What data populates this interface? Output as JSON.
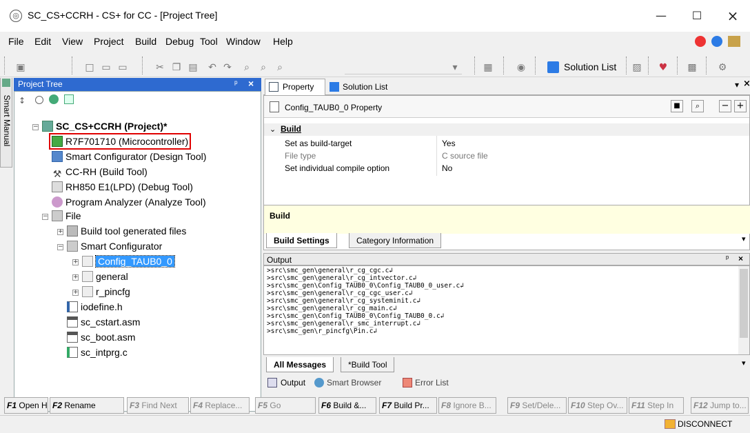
{
  "window": {
    "title": "SC_CS+CCRH - CS+ for CC - [Project Tree]",
    "minimize": "—",
    "maximize": "☐",
    "close": "×"
  },
  "menu": [
    "File",
    "Edit",
    "View",
    "Project",
    "Build",
    "Debug",
    "Tool",
    "Window",
    "Help"
  ],
  "toolbar": {
    "solution_list": "Solution List"
  },
  "side_tab": {
    "label": "Smart Manual"
  },
  "project_tree": {
    "header": "Project Tree",
    "header_pin": "ᵖ",
    "header_close": "×",
    "items": [
      {
        "label": "SC_CS+CCRH (Project)*"
      },
      {
        "label": "R7F701710 (Microcontroller)"
      },
      {
        "label": "Smart Configurator (Design Tool)"
      },
      {
        "label": "CC-RH (Build Tool)"
      },
      {
        "label": "RH850 E1(LPD) (Debug Tool)"
      },
      {
        "label": "Program Analyzer (Analyze Tool)"
      },
      {
        "label": "File"
      },
      {
        "label": "Build tool generated files"
      },
      {
        "label": "Smart Configurator"
      },
      {
        "label": "Config_TAUB0_0"
      },
      {
        "label": "general"
      },
      {
        "label": "r_pincfg"
      },
      {
        "label": "iodefine.h"
      },
      {
        "label": "sc_cstart.asm"
      },
      {
        "label": "sc_boot.asm"
      },
      {
        "label": "sc_intprg.c"
      }
    ]
  },
  "property": {
    "tab_property": "Property",
    "tab_solution_list": "Solution List",
    "title": "Config_TAUB0_0 Property",
    "category": "Build",
    "rows": [
      {
        "name": "Set as build-target",
        "value": "Yes"
      },
      {
        "name": "File type",
        "value": "C source file"
      },
      {
        "name": "Set individual compile option",
        "value": "No"
      }
    ],
    "description_title": "Build",
    "tabs": [
      "Build Settings",
      "Category Information"
    ]
  },
  "output": {
    "header": "Output",
    "lines": [
      ">src\\smc_gen\\general\\r_cg_cgc.c↲",
      ">src\\smc_gen\\general\\r_cg_intvector.c↲",
      ">src\\smc_gen\\Config_TAUB0_0\\Config_TAUB0_0_user.c↲",
      ">src\\smc_gen\\general\\r_cg_cgc_user.c↲",
      ">src\\smc_gen\\general\\r_cg_systeminit.c↲",
      ">src\\smc_gen\\general\\r_cg_main.c↲",
      ">src\\smc_gen\\Config_TAUB0_0\\Config_TAUB0_0.c↲",
      ">src\\smc_gen\\general\\r_smc_interrupt.c↲",
      ">src\\smc_gen\\r_pincfg\\Pin.c↲"
    ],
    "tabs": [
      "All Messages",
      "*Build Tool"
    ],
    "panel_tabs": [
      "Output",
      "Smart Browser",
      "Error List"
    ]
  },
  "fkeys": [
    {
      "key": "F1",
      "label": "Open H..."
    },
    {
      "key": "F2",
      "label": "Rename"
    },
    {
      "key": "F3",
      "label": "Find Next"
    },
    {
      "key": "F4",
      "label": "Replace..."
    },
    {
      "key": "F5",
      "label": "Go"
    },
    {
      "key": "F6",
      "label": "Build &..."
    },
    {
      "key": "F7",
      "label": "Build Pr..."
    },
    {
      "key": "F8",
      "label": "Ignore B..."
    },
    {
      "key": "F9",
      "label": "Set/Dele..."
    },
    {
      "key": "F10",
      "label": "Step Ov..."
    },
    {
      "key": "F11",
      "label": "Step In"
    },
    {
      "key": "F12",
      "label": "Jump to..."
    }
  ],
  "status": {
    "disconnect": "DISCONNECT"
  },
  "colors": {
    "accent": "#2e6ad0",
    "selection": "#3399ff",
    "highlight_box": "#e00000"
  }
}
